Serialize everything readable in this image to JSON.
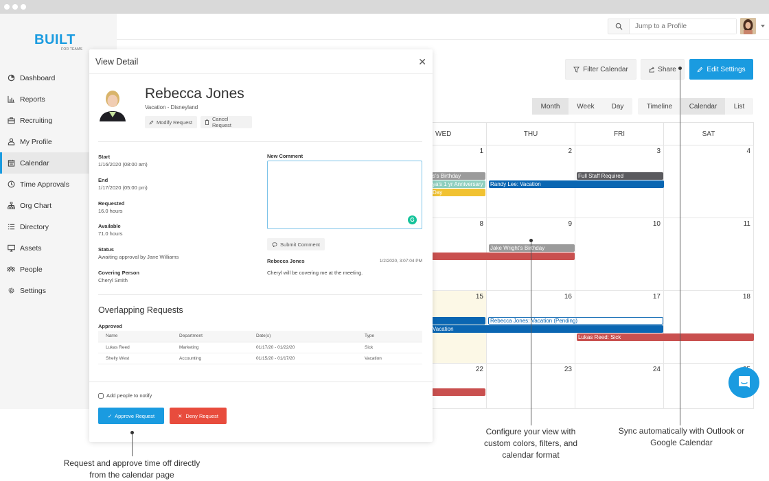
{
  "brand": {
    "name": "BUILT",
    "tagline": "FOR TEAMS"
  },
  "sidebar": {
    "items": [
      {
        "label": "Dashboard",
        "icon": "dashboard-icon"
      },
      {
        "label": "Reports",
        "icon": "bar-chart-icon"
      },
      {
        "label": "Recruiting",
        "icon": "briefcase-icon"
      },
      {
        "label": "My Profile",
        "icon": "user-icon"
      },
      {
        "label": "Calendar",
        "icon": "calendar-icon",
        "active": true
      },
      {
        "label": "Time Approvals",
        "icon": "clock-icon"
      },
      {
        "label": "Org Chart",
        "icon": "org-chart-icon"
      },
      {
        "label": "Directory",
        "icon": "list-icon"
      },
      {
        "label": "Assets",
        "icon": "monitor-icon"
      },
      {
        "label": "People",
        "icon": "people-icon"
      },
      {
        "label": "Settings",
        "icon": "gear-icon"
      }
    ]
  },
  "topbar": {
    "search_placeholder": "Jump to a Profile"
  },
  "toolbar": {
    "filter_label": "Filter Calendar",
    "share_label": "Share",
    "edit_label": "Edit Settings"
  },
  "view_modes": {
    "range": [
      "Month",
      "Week",
      "Day"
    ],
    "range_selected": "Month",
    "format": [
      "Timeline",
      "Calendar",
      "List"
    ],
    "format_selected": "Calendar"
  },
  "calendar": {
    "days": [
      "WED",
      "THU",
      "FRI",
      "SAT"
    ],
    "weeks": [
      [
        "1",
        "2",
        "3",
        "4"
      ],
      [
        "8",
        "9",
        "10",
        "11"
      ],
      [
        "15",
        "16",
        "17",
        "18"
      ],
      [
        "22",
        "23",
        "24",
        "25"
      ]
    ],
    "events": [
      {
        "label": "s's Birthday",
        "color": "#9b9b9b"
      },
      {
        "label": "ya's 1 yr Anniversary",
        "color": "#8fcfbf"
      },
      {
        "label": "Day",
        "color": "#f1c232"
      },
      {
        "label": "Randy Lee: Vacation",
        "color": "#0a66b2"
      },
      {
        "label": "Full Staff Required",
        "color": "#5a5a5e"
      },
      {
        "label": "Jake Wright's Birthday",
        "color": "#9b9b9b"
      },
      {
        "label": "",
        "color": "#c9504f"
      },
      {
        "label": "",
        "color": "#0a66b2"
      },
      {
        "label": "Rebecca Jones: Vacation (Pending)",
        "color": "#ffffff"
      },
      {
        "label": "Vacation",
        "color": "#0a66b2"
      },
      {
        "label": "Lukas Reed: Sick",
        "color": "#c9504f"
      },
      {
        "label": "",
        "color": "#c9504f"
      }
    ]
  },
  "modal": {
    "title": "View Detail",
    "name": "Rebecca Jones",
    "subtitle": "Vacation - Disneyland",
    "modify_label": "Modify Request",
    "cancel_label": "Cancel Request",
    "fields": [
      {
        "label": "Start",
        "value": "1/16/2020 (08:00 am)"
      },
      {
        "label": "End",
        "value": "1/17/2020 (05:00 pm)"
      },
      {
        "label": "Requested",
        "value": "16.0 hours"
      },
      {
        "label": "Available",
        "value": "71.0 hours"
      },
      {
        "label": "Status",
        "value": "Awaiting approval by Jane Williams"
      },
      {
        "label": "Covering Person",
        "value": "Cheryl Smith"
      }
    ],
    "new_comment_label": "New Comment",
    "submit_label": "Submit Comment",
    "comment": {
      "author": "Rebecca Jones",
      "time": "1/2/2020, 3:07:04 PM",
      "text": "Cheryl will be covering me at the meeting."
    },
    "overlap_title": "Overlapping Requests",
    "overlap_subtitle": "Approved",
    "overlap_columns": [
      "Name",
      "Department",
      "Date(s)",
      "Type"
    ],
    "overlap_rows": [
      [
        "Lukas Reed",
        "Marketing",
        "01/17/20 - 01/22/20",
        "Sick"
      ],
      [
        "Shelly West",
        "Accounting",
        "01/15/20 - 01/17/20",
        "Vacation"
      ]
    ],
    "notify_label": "Add people to notify",
    "approve_label": "Approve Request",
    "deny_label": "Deny Request"
  },
  "captions": {
    "left": "Request and approve time off directly from the calendar page",
    "middle": "Configure your view with custom colors, filters, and calendar format",
    "right": "Sync automatically with Outlook or Google Calendar"
  },
  "colors": {
    "accent": "#1a9be0",
    "danger": "#e84c3d",
    "event_blue": "#0a66b2",
    "event_red": "#c9504f"
  }
}
